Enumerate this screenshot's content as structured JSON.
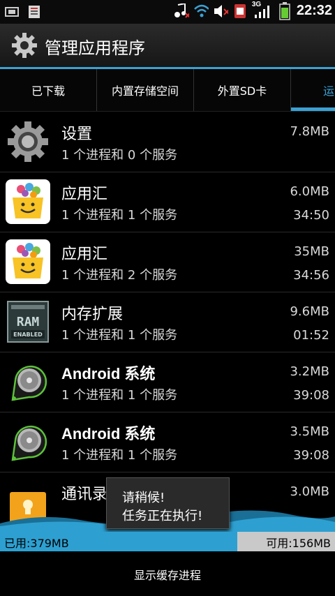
{
  "status_bar": {
    "time": "22:32",
    "network_label": "3G",
    "icons": [
      "sim-icon",
      "notification-icon",
      "music-muted-icon",
      "wifi-icon",
      "volume-muted-icon",
      "sim-card-icon",
      "signal-icon",
      "battery-icon"
    ]
  },
  "header": {
    "title": "管理应用程序",
    "icon": "gear-icon"
  },
  "tabs": [
    {
      "label": "已下载"
    },
    {
      "label": "内置存储空间"
    },
    {
      "label": "外置SD卡"
    },
    {
      "label": "运"
    }
  ],
  "apps": [
    {
      "name": "设置",
      "sub": "1 个进程和 0 个服务",
      "size": "7.8MB",
      "time": "",
      "icon": "settings-icon"
    },
    {
      "name": "应用汇",
      "sub": "1 个进程和 1 个服务",
      "size": "6.0MB",
      "time": "34:50",
      "icon": "appchina-icon"
    },
    {
      "name": "应用汇",
      "sub": "1 个进程和 2 个服务",
      "size": "35MB",
      "time": "34:56",
      "icon": "appchina-icon"
    },
    {
      "name": "内存扩展",
      "sub": "1 个进程和 1 个服务",
      "size": "9.6MB",
      "time": "01:52",
      "icon": "ram-enabled-icon"
    },
    {
      "name": "Android 系统",
      "sub": "1 个进程和 1 个服务",
      "size": "3.2MB",
      "time": "39:08",
      "icon": "android-system-icon"
    },
    {
      "name": "Android 系统",
      "sub": "1 个进程和 1 个服务",
      "size": "3.5MB",
      "time": "39:08",
      "icon": "android-system-icon"
    },
    {
      "name": "通讯录",
      "sub": "",
      "size": "3.0MB",
      "time": "",
      "icon": "contacts-icon"
    }
  ],
  "toast": {
    "line1": "请稍候!",
    "line2": "任务正在执行!"
  },
  "memory": {
    "used_label": "已用:379MB",
    "free_label": "可用:156MB"
  },
  "bottom_button": {
    "label": "显示缓存进程"
  },
  "colors": {
    "accent": "#3aa1d3",
    "used_bar": "#2da0d1",
    "free_bar": "#c9c9c9"
  }
}
